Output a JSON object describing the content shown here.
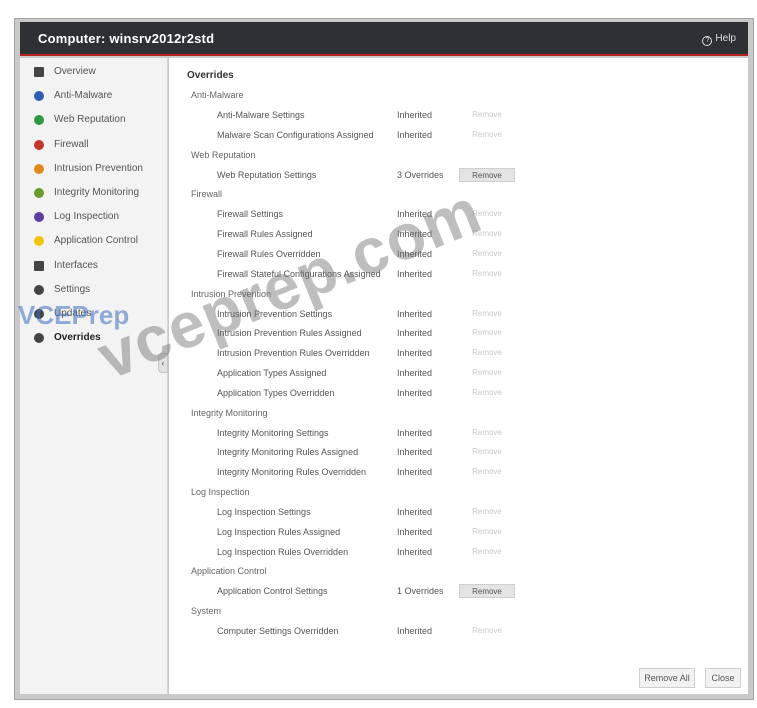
{
  "window": {
    "title": "Computer: winsrv2012r2std",
    "help_label": "Help"
  },
  "sidebar": {
    "items": [
      {
        "label": "Overview",
        "icon": "overview-icon",
        "color": "#444444"
      },
      {
        "label": "Anti-Malware",
        "icon": "anti-malware-icon",
        "color": "#2f5fb3"
      },
      {
        "label": "Web Reputation",
        "icon": "web-reputation-icon",
        "color": "#2e9a3f"
      },
      {
        "label": "Firewall",
        "icon": "firewall-icon",
        "color": "#c0392b"
      },
      {
        "label": "Intrusion Prevention",
        "icon": "intrusion-prevention-icon",
        "color": "#e08a1e"
      },
      {
        "label": "Integrity Monitoring",
        "icon": "integrity-monitoring-icon",
        "color": "#6a9a2b"
      },
      {
        "label": "Log Inspection",
        "icon": "log-inspection-icon",
        "color": "#5b3fa0"
      },
      {
        "label": "Application Control",
        "icon": "application-control-icon",
        "color": "#f1c40f"
      },
      {
        "label": "Interfaces",
        "icon": "interfaces-icon",
        "color": "#444444"
      },
      {
        "label": "Settings",
        "icon": "settings-icon",
        "color": "#444444"
      },
      {
        "label": "Updates",
        "icon": "updates-icon",
        "color": "#444444"
      },
      {
        "label": "Overrides",
        "icon": "overrides-icon",
        "color": "#444444"
      }
    ],
    "active": "Overrides"
  },
  "main": {
    "title": "Overrides",
    "sections": [
      {
        "name": "Anti-Malware",
        "rows": [
          {
            "name": "Anti-Malware Settings",
            "state": "Inherited",
            "remove": "Remove",
            "enabled": false
          },
          {
            "name": "Malware Scan Configurations Assigned",
            "state": "Inherited",
            "remove": "Remove",
            "enabled": false
          }
        ]
      },
      {
        "name": "Web Reputation",
        "rows": [
          {
            "name": "Web Reputation Settings",
            "state": "3 Overrides",
            "remove": "Remove",
            "enabled": true
          }
        ]
      },
      {
        "name": "Firewall",
        "rows": [
          {
            "name": "Firewall Settings",
            "state": "Inherited",
            "remove": "Remove",
            "enabled": false
          },
          {
            "name": "Firewall Rules Assigned",
            "state": "Inherited",
            "remove": "Remove",
            "enabled": false
          },
          {
            "name": "Firewall Rules Overridden",
            "state": "Inherited",
            "remove": "Remove",
            "enabled": false
          },
          {
            "name": "Firewall Stateful Configurations Assigned",
            "state": "Inherited",
            "remove": "Remove",
            "enabled": false
          }
        ]
      },
      {
        "name": "Intrusion Prevention",
        "rows": [
          {
            "name": "Intrusion Prevention Settings",
            "state": "Inherited",
            "remove": "Remove",
            "enabled": false
          },
          {
            "name": "Intrusion Prevention Rules Assigned",
            "state": "Inherited",
            "remove": "Remove",
            "enabled": false
          },
          {
            "name": "Intrusion Prevention Rules Overridden",
            "state": "Inherited",
            "remove": "Remove",
            "enabled": false
          },
          {
            "name": "Application Types Assigned",
            "state": "Inherited",
            "remove": "Remove",
            "enabled": false
          },
          {
            "name": "Application Types Overridden",
            "state": "Inherited",
            "remove": "Remove",
            "enabled": false
          }
        ]
      },
      {
        "name": "Integrity Monitoring",
        "rows": [
          {
            "name": "Integrity Monitoring Settings",
            "state": "Inherited",
            "remove": "Remove",
            "enabled": false
          },
          {
            "name": "Integrity Monitoring Rules Assigned",
            "state": "Inherited",
            "remove": "Remove",
            "enabled": false
          },
          {
            "name": "Integrity Monitoring Rules Overridden",
            "state": "Inherited",
            "remove": "Remove",
            "enabled": false
          }
        ]
      },
      {
        "name": "Log Inspection",
        "rows": [
          {
            "name": "Log Inspection Settings",
            "state": "Inherited",
            "remove": "Remove",
            "enabled": false
          },
          {
            "name": "Log Inspection Rules Assigned",
            "state": "Inherited",
            "remove": "Remove",
            "enabled": false
          },
          {
            "name": "Log Inspection Rules Overridden",
            "state": "Inherited",
            "remove": "Remove",
            "enabled": false
          }
        ]
      },
      {
        "name": "Application Control",
        "rows": [
          {
            "name": "Application Control Settings",
            "state": "1 Overrides",
            "remove": "Remove",
            "enabled": true
          }
        ]
      },
      {
        "name": "System",
        "rows": [
          {
            "name": "Computer Settings Overridden",
            "state": "Inherited",
            "remove": "Remove",
            "enabled": false
          }
        ]
      }
    ]
  },
  "footer": {
    "remove_all_label": "Remove All",
    "close_label": "Close"
  },
  "watermark": {
    "text": "vceprep.com",
    "logo": "VCEPrep"
  }
}
